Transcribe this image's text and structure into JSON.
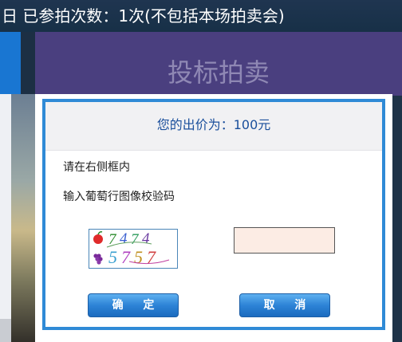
{
  "top_bar": {
    "text": "日 已参拍次数：1次(不包括本场拍卖会)"
  },
  "background": {
    "title": "投标拍卖"
  },
  "dialog": {
    "title": "您的出价为：100元",
    "instruction_line1": "请在右侧框内",
    "instruction_line2": "输入葡萄行图像校验码",
    "captcha_value": "",
    "confirm_label": "确 定",
    "cancel_label": "取 消"
  },
  "captcha_image": {
    "symbols_text": "7474 5757",
    "fruit_icons": [
      "apple-icon",
      "grape-icon"
    ]
  },
  "colors": {
    "dialog_border": "#2f8ad6",
    "title_text": "#1a4f9c",
    "button": "#2d83d6",
    "input_bg": "#fcece4",
    "header_bg": "#4a3f7f"
  }
}
